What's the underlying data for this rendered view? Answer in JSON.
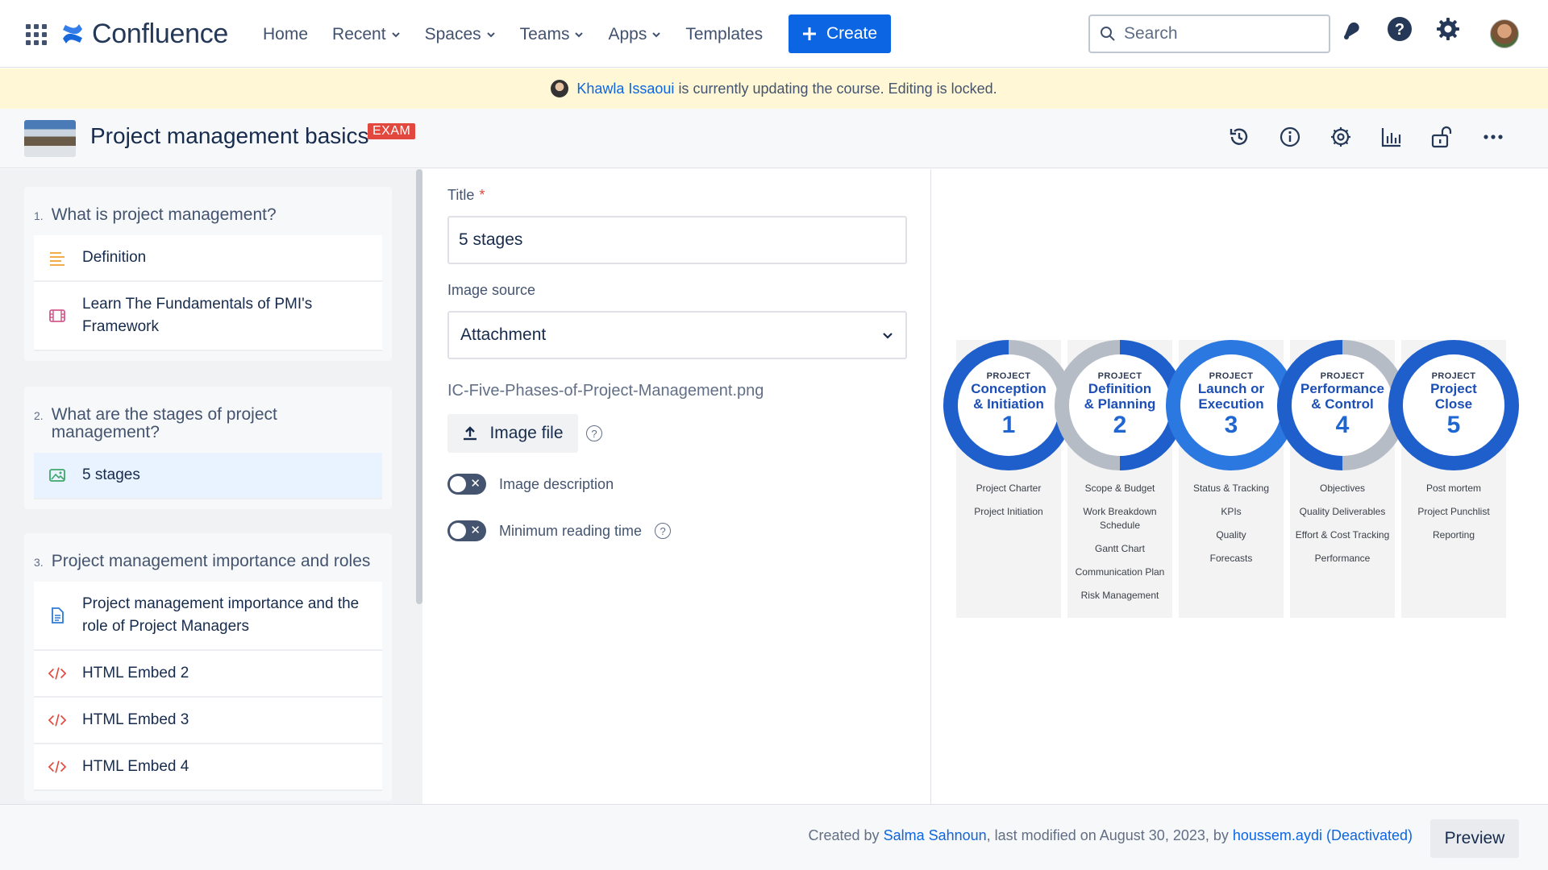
{
  "nav": {
    "logo_text": "Confluence",
    "items": [
      {
        "label": "Home",
        "dropdown": false
      },
      {
        "label": "Recent",
        "dropdown": true
      },
      {
        "label": "Spaces",
        "dropdown": true
      },
      {
        "label": "Teams",
        "dropdown": true
      },
      {
        "label": "Apps",
        "dropdown": true
      },
      {
        "label": "Templates",
        "dropdown": false
      }
    ],
    "create_label": "Create",
    "search_placeholder": "Search",
    "icons": [
      "app-switcher-icon",
      "notifications-icon",
      "help-icon",
      "settings-icon",
      "profile-avatar"
    ]
  },
  "banner": {
    "user": "Khawla Issaoui",
    "message": "is currently updating the course. Editing is locked."
  },
  "course": {
    "title": "Project management basics",
    "badge": "EXAM",
    "tools": [
      "history-icon",
      "info-icon",
      "settings-icon",
      "analytics-icon",
      "unlock-icon",
      "more-icon"
    ]
  },
  "sidebar": {
    "sections": [
      {
        "number": "1.",
        "title": "What is project management?",
        "lessons": [
          {
            "label": "Definition",
            "icon": "text-lines-icon"
          },
          {
            "label": "Learn The Fundamentals of PMI's Framework",
            "icon": "video-icon"
          }
        ]
      },
      {
        "number": "2.",
        "title": "What are the stages of project management?",
        "lessons": [
          {
            "label": "5 stages",
            "icon": "image-icon",
            "active": true
          }
        ]
      },
      {
        "number": "3.",
        "title": "Project management importance and roles",
        "lessons": [
          {
            "label": "Project management importance and the role of Project Managers",
            "icon": "document-icon"
          },
          {
            "label": "HTML Embed 2",
            "icon": "code-icon"
          },
          {
            "label": "HTML Embed 3",
            "icon": "code-icon"
          },
          {
            "label": "HTML Embed 4",
            "icon": "code-icon"
          }
        ]
      }
    ]
  },
  "form": {
    "title_label": "Title",
    "required_mark": "*",
    "title_value": "5 stages",
    "image_source_label": "Image source",
    "image_source_value": "Attachment",
    "filename": "IC-Five-Phases-of-Project-Management.png",
    "upload_label": "Image file",
    "help_glyph": "?",
    "toggles": [
      {
        "label": "Image description",
        "on": false
      },
      {
        "label": "Minimum reading time",
        "on": false
      }
    ]
  },
  "preview": {
    "phases": [
      {
        "small": "PROJECT",
        "title1": "Conception",
        "title2": "& Initiation",
        "num": "1",
        "items": [
          "Project Charter",
          "Project Initiation"
        ]
      },
      {
        "small": "PROJECT",
        "title1": "Definition",
        "title2": "& Planning",
        "num": "2",
        "items": [
          "Scope & Budget",
          "Work Breakdown Schedule",
          "Gantt Chart",
          "Communication Plan",
          "Risk Management"
        ]
      },
      {
        "small": "PROJECT",
        "title1": "Launch or",
        "title2": "Execution",
        "num": "3",
        "items": [
          "Status & Tracking",
          "KPIs",
          "Quality",
          "Forecasts"
        ]
      },
      {
        "small": "PROJECT",
        "title1": "Performance",
        "title2": "& Control",
        "num": "4",
        "items": [
          "Objectives",
          "Quality Deliverables",
          "Effort & Cost Tracking",
          "Performance"
        ]
      },
      {
        "small": "PROJECT",
        "title1": "Project",
        "title2": "Close",
        "num": "5",
        "items": [
          "Post mortem",
          "Project Punchlist",
          "Reporting"
        ]
      }
    ],
    "colors": {
      "ring_blue": "#1f5fcc",
      "ring_gray": "#b5bcc6",
      "accent": "#1f66d1"
    }
  },
  "footer": {
    "created_prefix": "Created by",
    "creator": "Salma Sahnoun",
    "modified_text": ", last modified on August 30, 2023, by",
    "modifier": "houssem.aydi (Deactivated)",
    "preview_label": "Preview"
  },
  "colors": {
    "brand": "#0c66e4",
    "banner_bg": "#fff7d6",
    "badge": "#e2483d"
  }
}
